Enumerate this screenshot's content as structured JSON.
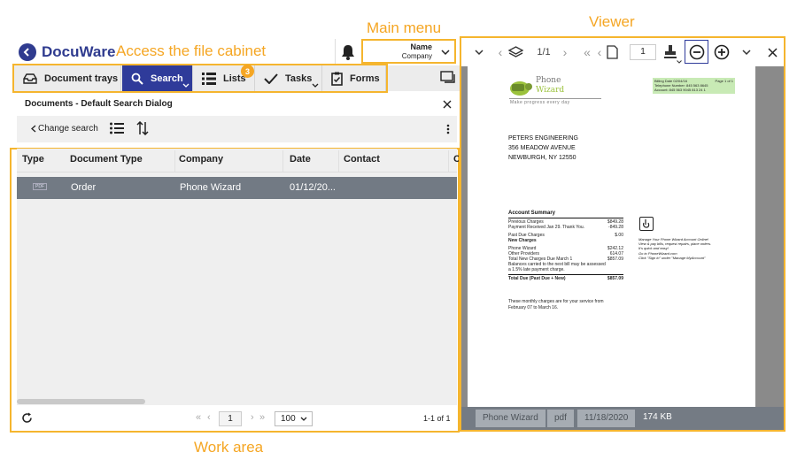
{
  "callouts": {
    "main_menu": "Main menu",
    "viewer": "Viewer",
    "access": "Access the file cabinet",
    "work_area": "Work area"
  },
  "logo": {
    "text": "DocuWare"
  },
  "user": {
    "name": "Name",
    "company": "Company"
  },
  "toolbar": {
    "document_trays": "Document trays",
    "search": "Search",
    "lists": "Lists",
    "lists_badge": "3",
    "tasks": "Tasks",
    "forms": "Forms"
  },
  "dialog": {
    "title": "Documents - Default Search Dialog",
    "change_search": "Change search"
  },
  "table": {
    "headers": [
      "Type",
      "Document Type",
      "Company",
      "Date",
      "Contact",
      "C"
    ],
    "rows": [
      {
        "type": "PDF",
        "document_type": "Order",
        "company": "Phone Wizard",
        "date": "01/12/20..."
      }
    ]
  },
  "pager": {
    "page": "1",
    "page_size": "100",
    "count": "1-1 of 1"
  },
  "viewer": {
    "page_counter": "1/1",
    "page_input": "1",
    "footer": {
      "name": "Phone Wizard",
      "format": "pdf",
      "date": "11/18/2020",
      "size": "174 KB"
    }
  },
  "document": {
    "brand_top": "Phone",
    "brand_bottom": "Wizard",
    "tagline": "Make progress every day",
    "billing_box": [
      "Billing Date 02/04/16",
      "Page 1 of 1",
      "Telephone Number: 845 563 8645",
      "Account: 845 563 9045 813 24 1"
    ],
    "address": [
      "PETERS ENGINEERING",
      "356 MEADOW AVENUE",
      "NEWBURGH, NY 12550"
    ],
    "summary_title": "Account Summary",
    "summary_rows": [
      [
        "Previous Charges",
        "$849.28"
      ],
      [
        "Payment Received Jan 29. Thank You.",
        "-849.28"
      ],
      [
        "Past Due Charges",
        "$.00"
      ],
      [
        "New Charges",
        ""
      ],
      [
        "Phone Wizard",
        "$242.12"
      ],
      [
        "Other Providers",
        "614.07"
      ],
      [
        "Total New Charges Due March 1",
        "$857.09"
      ],
      [
        "Balances carried to the next bill may be assessed",
        ""
      ],
      [
        "a 1.5% late payment charge.",
        ""
      ],
      [
        "Total Due (Past Due + New)",
        "$857.09"
      ]
    ],
    "side_note": [
      "Manage Your Phone Wizard Account Online!",
      "View & pay bills, request repairs, place orders.",
      "It's quick and easy!",
      "Go to PhoneWizard.com",
      "Click \"Sign in\" under \"Manage MyAccount\""
    ],
    "footer_note": [
      "These monthly charges are for your service from",
      "February 07 to March 16."
    ]
  }
}
